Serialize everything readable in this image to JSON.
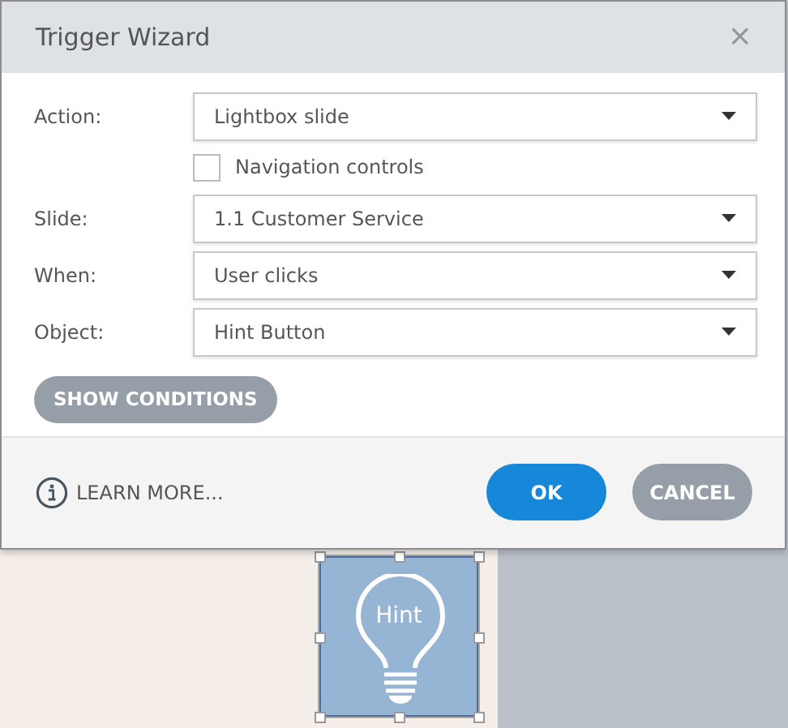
{
  "dialog": {
    "title": "Trigger Wizard",
    "close": "×",
    "fields": [
      {
        "kind": "select",
        "label": "Action:",
        "value": "Lightbox slide"
      },
      {
        "kind": "checkbox",
        "label": "Navigation controls",
        "checked": false
      },
      {
        "kind": "select",
        "label": "Slide:",
        "value": "1.1 Customer Service"
      },
      {
        "kind": "select",
        "label": "When:",
        "value": "User clicks"
      },
      {
        "kind": "select",
        "label": "Object:",
        "value": "Hint Button"
      }
    ],
    "show_conditions": "SHOW CONDITIONS",
    "learn_more": "LEARN MORE...",
    "buttons": [
      {
        "kind": "primary",
        "label": "OK"
      },
      {
        "kind": "secondary",
        "label": "CANCEL"
      }
    ]
  },
  "canvas": {
    "hint_button": {
      "label": "Hint",
      "selected": true
    }
  }
}
